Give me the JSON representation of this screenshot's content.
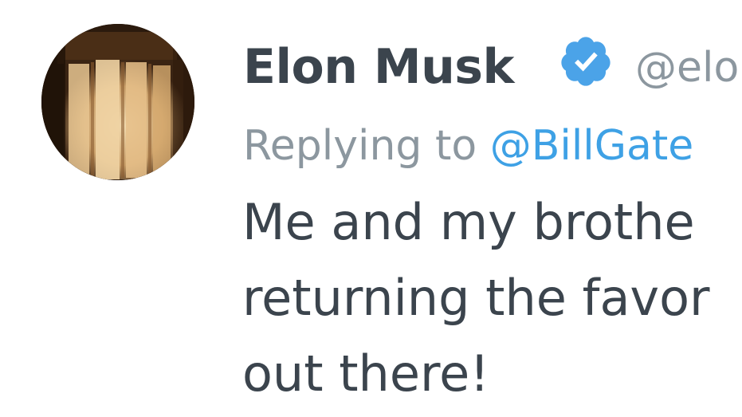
{
  "tweet": {
    "author_name": "Elon Musk",
    "author_handle": "@elo",
    "verified_icon": "verified-badge-icon",
    "reply_prefix": "Replying to ",
    "reply_mention": "@BillGate",
    "text_lines": [
      "Me and my brothe",
      "returning the favor",
      "out there!"
    ]
  },
  "colors": {
    "name": "#3b444d",
    "secondary": "#8c979f",
    "link": "#3ea1e5",
    "verified": "#4ba3e8"
  }
}
